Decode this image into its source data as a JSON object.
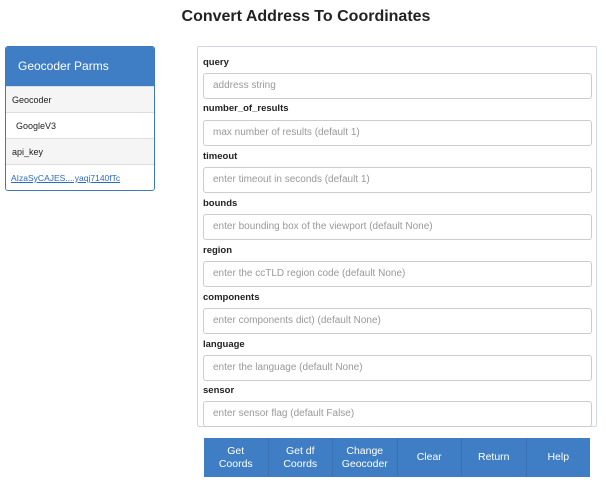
{
  "page": {
    "title": "Convert Address To Coordinates"
  },
  "sidebar": {
    "header": "Geocoder Parms",
    "geocoder_label": "Geocoder",
    "geocoder_value": "GoogleV3",
    "api_key_label": "api_key",
    "api_key_value": "AIzaSyCAJES....yaqj7140fTc"
  },
  "form": {
    "fields": [
      {
        "label": "query",
        "placeholder": "address string"
      },
      {
        "label": "number_of_results",
        "placeholder": "max number of results (default 1)"
      },
      {
        "label": "timeout",
        "placeholder": "enter timeout in seconds (default 1)"
      },
      {
        "label": "bounds",
        "placeholder": "enter bounding box of the viewport (default None)"
      },
      {
        "label": "region",
        "placeholder": "enter the ccTLD region code (default None)"
      },
      {
        "label": "components",
        "placeholder": "enter components dict) (default None)"
      },
      {
        "label": "language",
        "placeholder": "enter the language (default None)"
      },
      {
        "label": "sensor",
        "placeholder": "enter sensor flag (default False)"
      }
    ]
  },
  "buttons": {
    "get_coords": "Get\nCoords",
    "get_df_coords": "Get df\nCoords",
    "change_geocoder": "Change\nGeocoder",
    "clear": "Clear",
    "return": "Return",
    "help": "Help"
  },
  "colors": {
    "accent": "#3f7ec4",
    "link": "#2a6bbf"
  }
}
